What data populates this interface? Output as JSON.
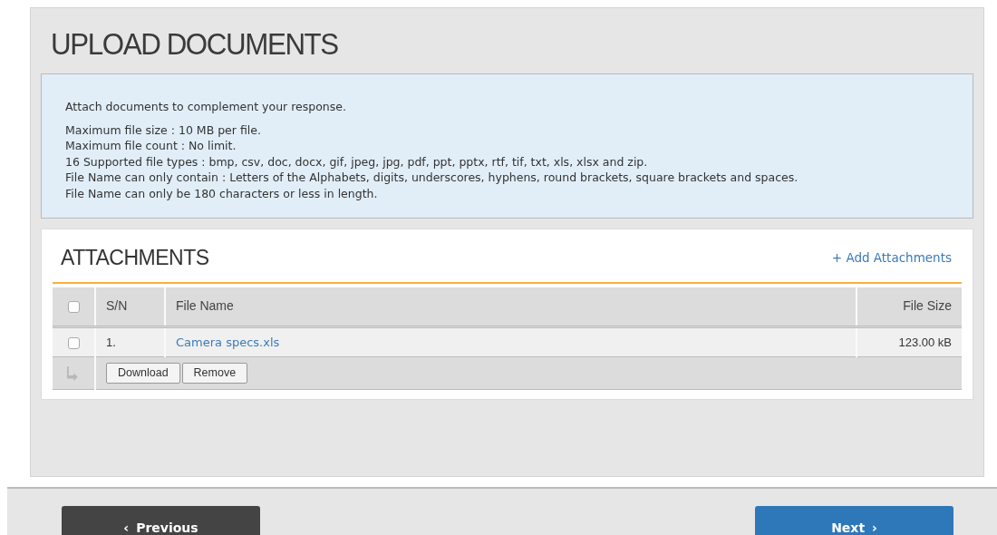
{
  "title": "UPLOAD DOCUMENTS",
  "info": {
    "intro": "Attach documents to complement your response.",
    "lines": [
      "Maximum file size : 10 MB per file.",
      "Maximum file count : No limit.",
      "16 Supported file types : bmp, csv, doc, docx, gif, jpeg, jpg, pdf, ppt, pptx, rtf, tif, txt, xls, xlsx and zip.",
      "File Name can only contain : Letters of the Alphabets, digits, underscores, hyphens, round brackets, square brackets and spaces.",
      "File Name can only be 180 characters or less in length."
    ]
  },
  "attachments": {
    "title": "ATTACHMENTS",
    "add_link": "+ Add Attachments",
    "table": {
      "select_all_checked": false,
      "columns": [
        "S/N",
        "File Name",
        "File Size"
      ],
      "rows": [
        {
          "checked": false,
          "sn": "1.",
          "file_name": "Camera specs.xls",
          "file_size": "123.00 kB"
        }
      ]
    },
    "actions": [
      "Download",
      "Remove"
    ]
  },
  "nav": {
    "previous": {
      "icon": "‹",
      "label": "Previous"
    },
    "next": {
      "label": "Next",
      "icon": "›"
    }
  }
}
